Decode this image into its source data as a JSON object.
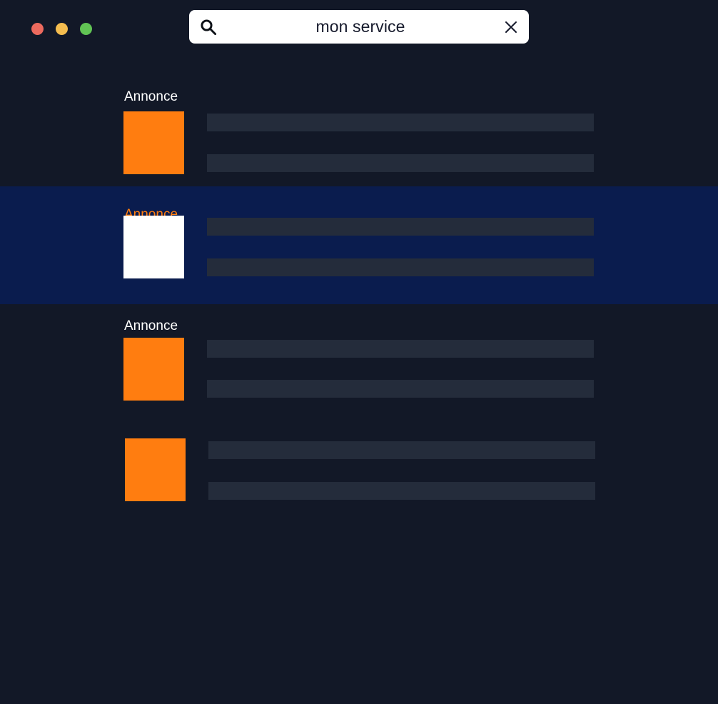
{
  "window": {
    "background_color": "#121827",
    "controls": [
      {
        "name": "close",
        "color": "#EC6A5E"
      },
      {
        "name": "minimize",
        "color": "#F5BD4F"
      },
      {
        "name": "zoom",
        "color": "#61C454"
      }
    ]
  },
  "search": {
    "value": "mon service",
    "placeholder": "",
    "search_icon": "search-icon",
    "clear_icon": "close-icon",
    "background_color": "#FFFFFF",
    "text_color": "#15192B"
  },
  "results": {
    "accent_color": "#FF7D10",
    "highlight_color": "#0A1C4E",
    "skeleton_color": "#242C3B",
    "items": [
      {
        "label": "Annonce",
        "has_label": true,
        "highlighted": false,
        "thumbnail": "orange",
        "lines": 2
      },
      {
        "label": "Annonce",
        "has_label": true,
        "highlighted": true,
        "thumbnail": "white",
        "lines": 2
      },
      {
        "label": "Annonce",
        "has_label": true,
        "highlighted": false,
        "thumbnail": "orange",
        "lines": 2
      },
      {
        "label": "",
        "has_label": false,
        "highlighted": false,
        "thumbnail": "orange",
        "lines": 2
      }
    ]
  }
}
